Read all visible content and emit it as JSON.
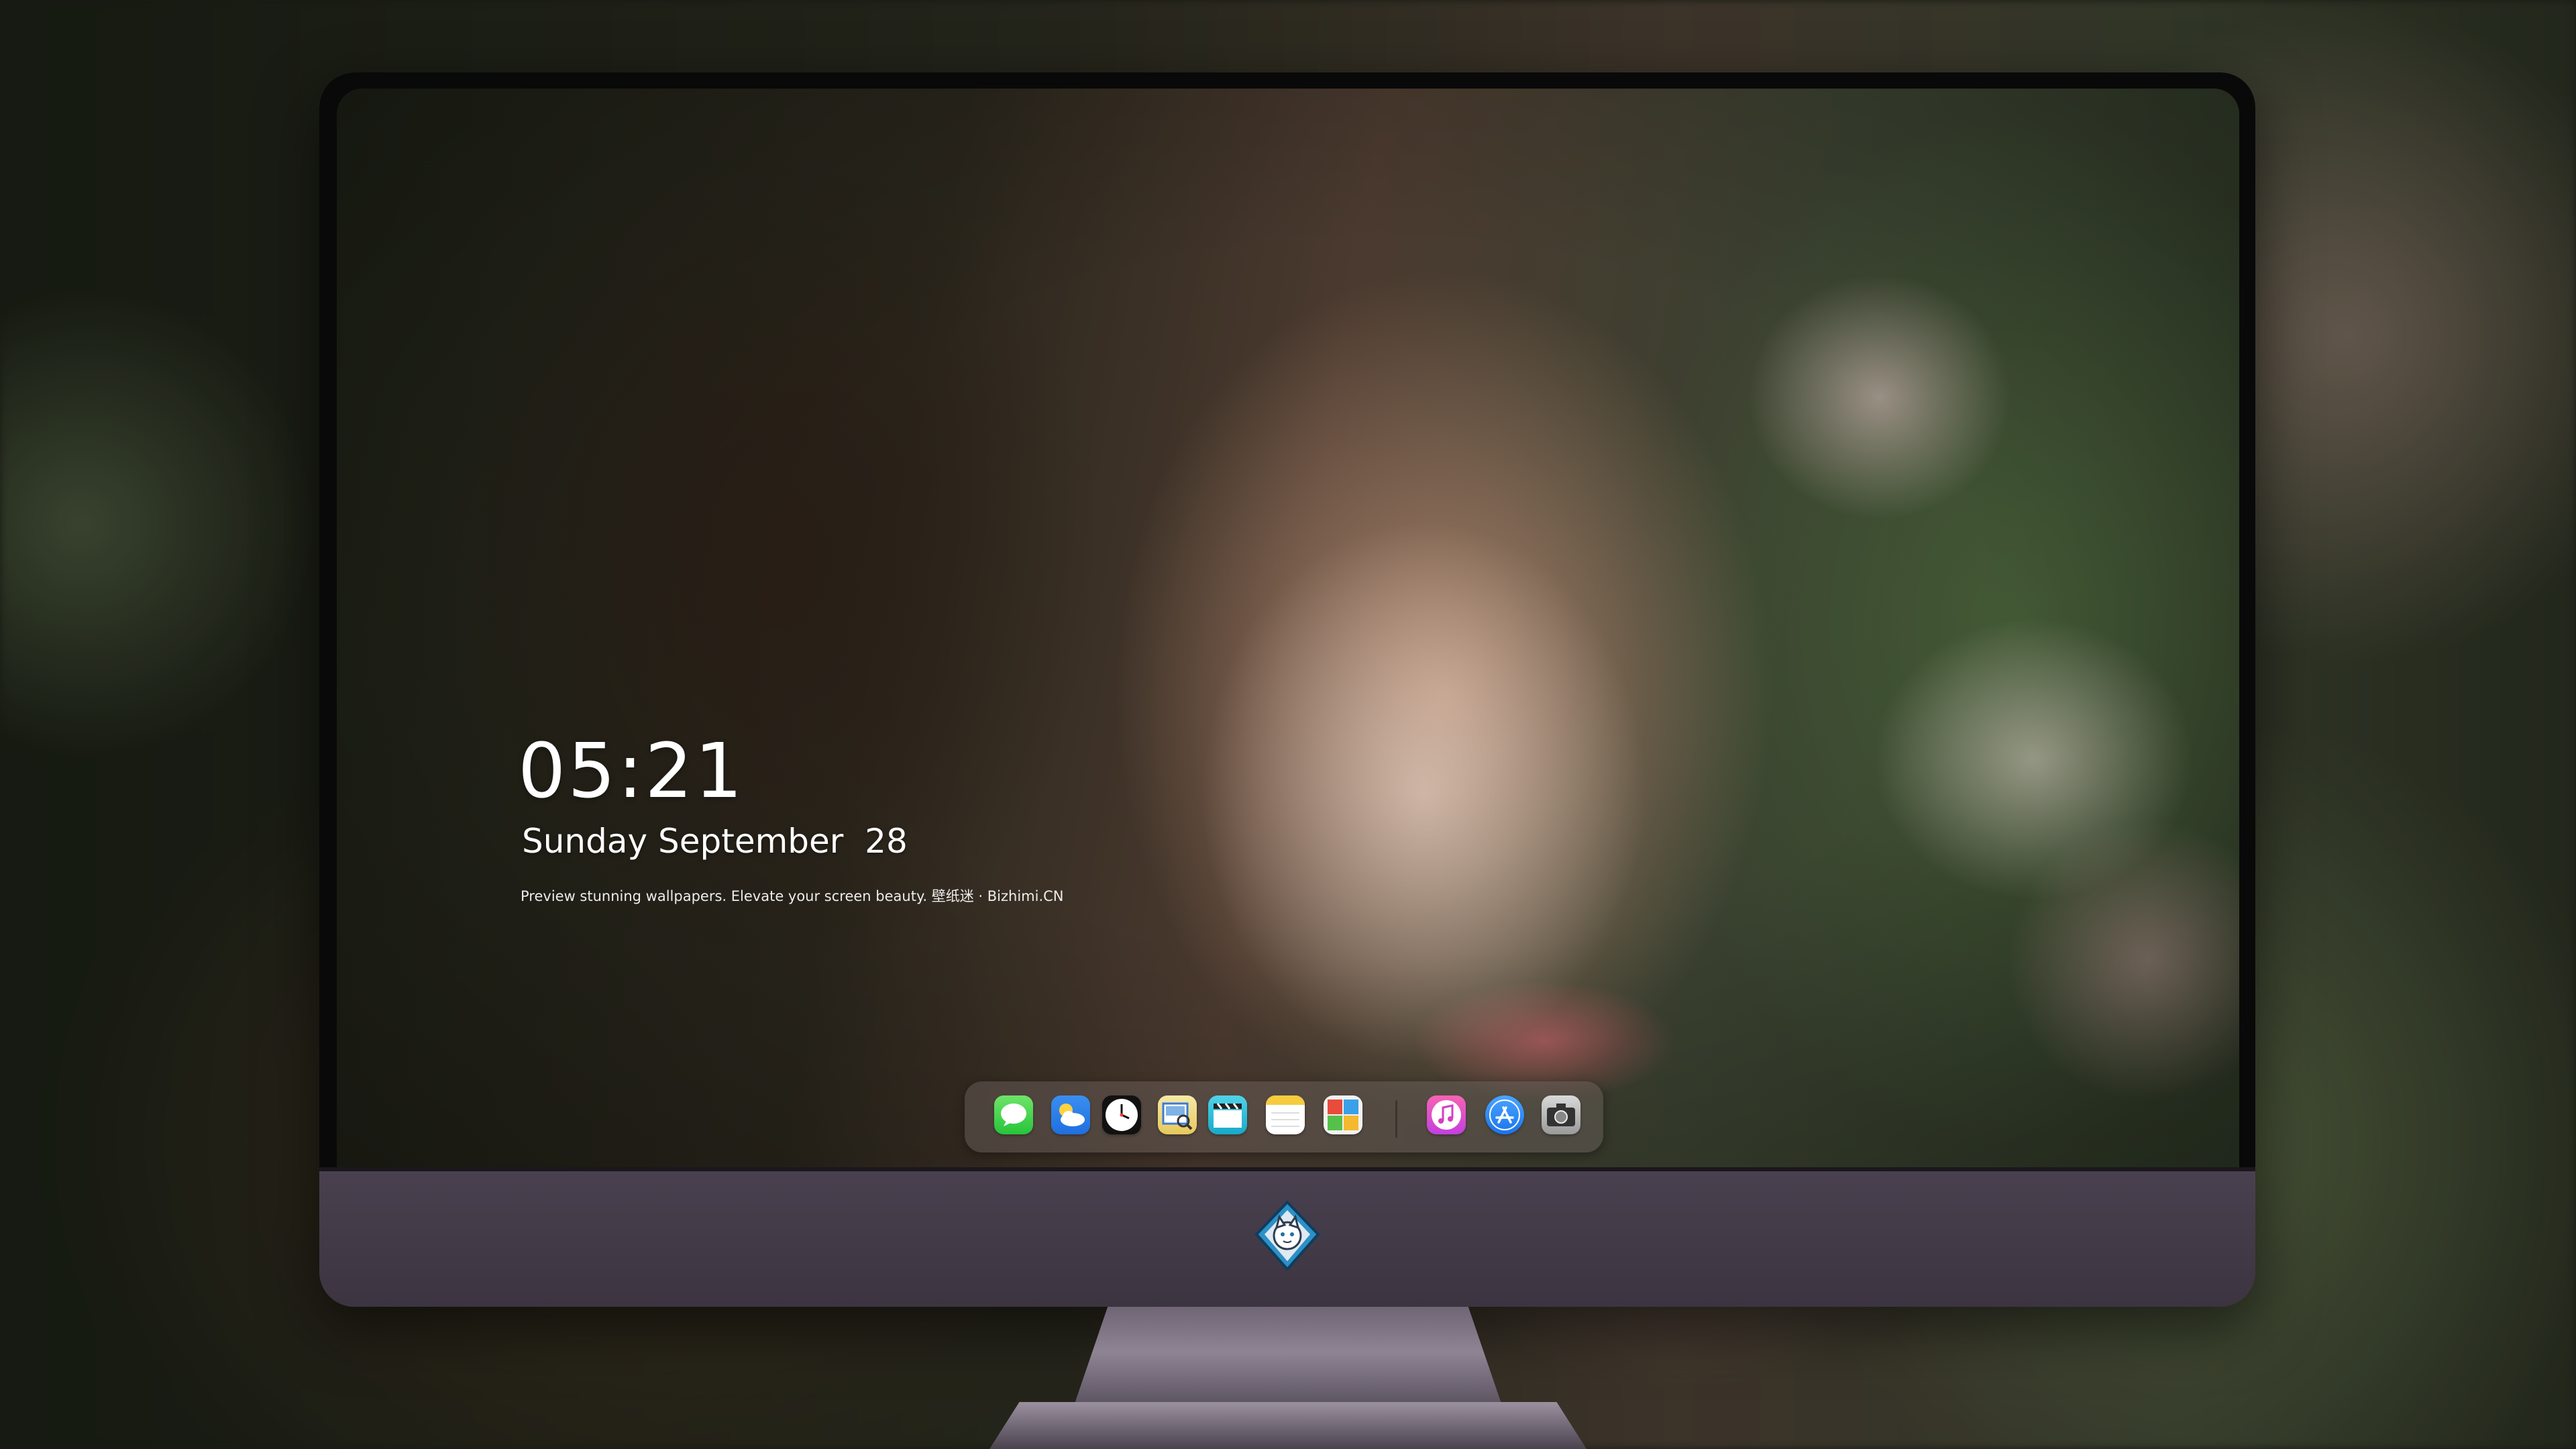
{
  "lock_screen": {
    "time": "05:21",
    "date": "Sunday September  28",
    "tagline": "Preview stunning wallpapers. Elevate your screen beauty. 壁纸迷 · Bizhimi.CN"
  },
  "dock": {
    "apps": [
      {
        "icon": "messages-icon"
      },
      {
        "icon": "weather-icon"
      },
      {
        "icon": "clock-icon"
      },
      {
        "icon": "preview-icon"
      },
      {
        "icon": "clips-icon"
      },
      {
        "icon": "notes-icon"
      },
      {
        "icon": "photo-booth-icon"
      },
      {
        "icon": "music-icon"
      },
      {
        "icon": "app-store-icon"
      },
      {
        "icon": "camera-icon"
      }
    ]
  },
  "colors": {
    "monitor_chin": "#3e3540",
    "bezel": "#090909",
    "text": "#ffffff"
  },
  "branding": {
    "logo_icon": "cat-mascot-icon"
  }
}
